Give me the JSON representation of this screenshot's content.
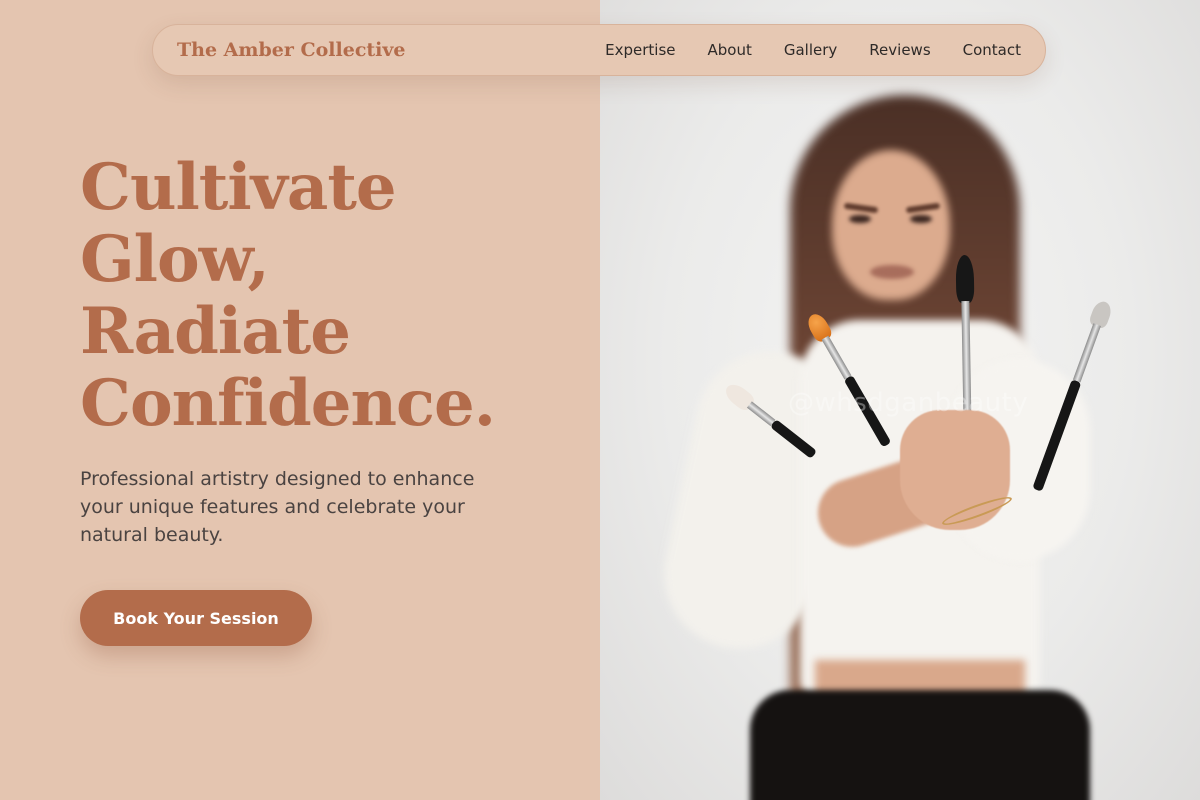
{
  "navbar": {
    "brand": "The Amber Collective",
    "links": [
      "Expertise",
      "About",
      "Gallery",
      "Reviews",
      "Contact"
    ]
  },
  "hero": {
    "title_lines": [
      "Cultivate",
      "Glow,",
      "Radiate",
      "Confidence."
    ],
    "subtitle": "Professional artistry designed to enhance your unique features and celebrate your natural beauty.",
    "cta_label": "Book Your Session"
  },
  "photo": {
    "watermark": "@whsdganbeauty"
  },
  "colors": {
    "accent": "#b36c4b",
    "left_background": "#e4c5b0",
    "nav_background": "#e6c8b3",
    "text_dark": "#2e2a28",
    "text_body": "#4a4341"
  }
}
